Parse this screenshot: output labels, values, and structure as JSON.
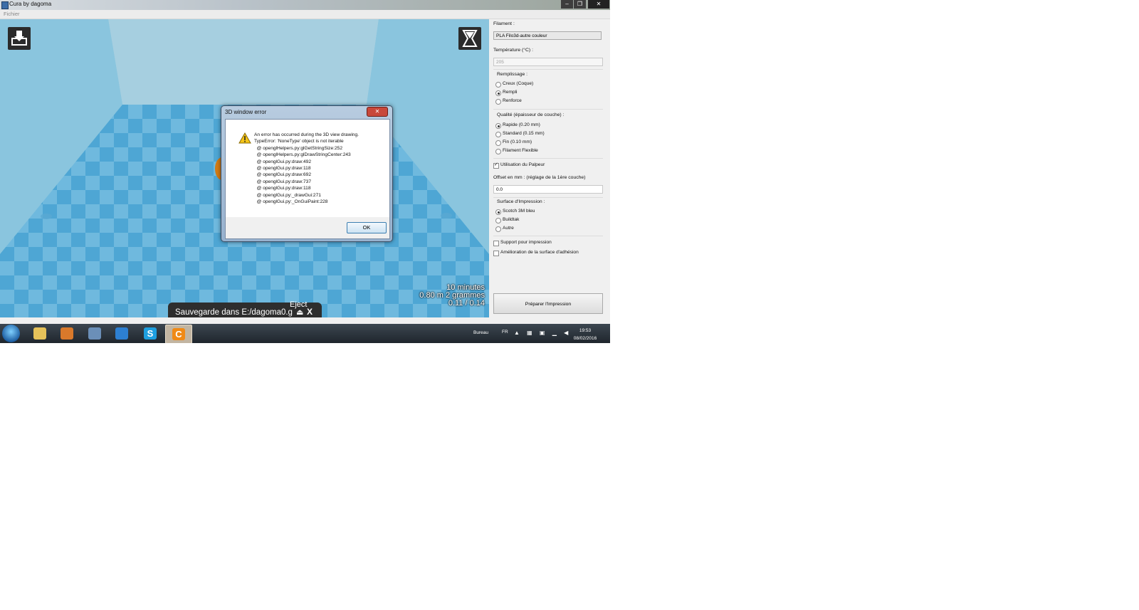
{
  "window": {
    "title": "Cura by dagoma",
    "min": "–",
    "max": "❐",
    "close": "✕"
  },
  "menu": {
    "file": "Fichier"
  },
  "viewport": {
    "print_time": "10 minutes",
    "print_material": "0.80 m 2 grammes",
    "print_cost": "0.11 / 0.14",
    "save_text": "Sauvegarde dans E:/dagoma0.g",
    "eject_label": "Eject",
    "eject_icon": "⏏",
    "close_icon": "X"
  },
  "dialog": {
    "title": "3D window error",
    "close": "✕",
    "message": "An error has occurred during the 3D view drawing.\nTypeError: 'NoneType' object is not iterable\n  @ openglHelpers.py:glGetStringSize:252\n  @ openglHelpers.py:glDrawStringCenter:243\n  @ openglGui.py:draw:492\n  @ openglGui.py:draw:118\n  @ openglGui.py:draw:692\n  @ openglGui.py:draw:737\n  @ openglGui.py:draw:118\n  @ openglGui.py:_drawGui:271\n  @ openglGui.py:_OnGuiPaint:228",
    "ok": "OK"
  },
  "panel": {
    "filament_label": "Filament :",
    "filament_value": "PLA Filo3d-autre couleur",
    "temperature_label": "Température (°C) :",
    "temperature_value": "205",
    "infill_label": "Remplissage :",
    "infill_options": [
      "Creux (Coque)",
      "Rempli",
      "Renforce"
    ],
    "quality_label": "Qualité (épaisseur de couche) :",
    "quality_options": [
      "Rapide (0.20 mm)",
      "Standard (0.15 mm)",
      "Fin (0.10 mm)",
      "Filament Flexible"
    ],
    "probe_label": "Utilisation du Palpeur",
    "offset_label": "Offset en mm : (réglage de la 1ère couche)",
    "offset_value": "0.0",
    "surface_label": "Surface d'Impression :",
    "surface_options": [
      "Scotch 3M bleu",
      "Buildtak",
      "Autre"
    ],
    "support_label": "Support pour impression",
    "adhesion_label": "Amélioration de la surface d'adhésion",
    "prepare_button": "Préparer l'Impression"
  },
  "taskbar": {
    "bureau": "Bureau",
    "lang": "FR",
    "time": "19:53",
    "date": "08/02/2016",
    "skype_glyph": "S",
    "cura_glyph": "C"
  }
}
